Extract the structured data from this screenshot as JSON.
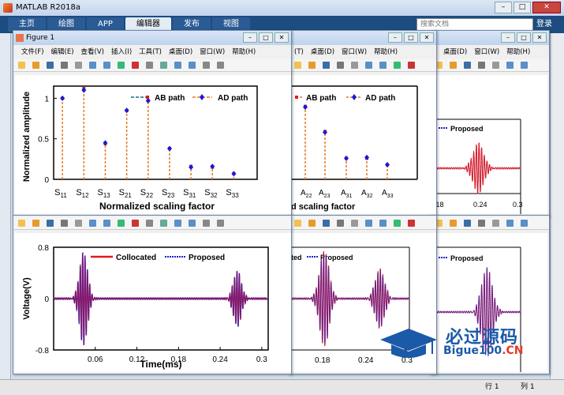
{
  "app": {
    "title": "MATLAB R2018a",
    "tabs": [
      "主页",
      "绘图",
      "APP",
      "编辑器",
      "发布",
      "视图"
    ],
    "active_tab": "编辑器",
    "search_placeholder": "搜索文档",
    "login_label": "登录",
    "status_row_label": "行",
    "status_row_value": "1",
    "status_col_label": "列",
    "status_col_value": "1"
  },
  "figure": {
    "title": "Figure 1",
    "menu": [
      "文件(F)",
      "编辑(E)",
      "查看(V)",
      "插入(I)",
      "工具(T)",
      "桌面(D)",
      "窗口(W)",
      "帮助(H)"
    ],
    "menu_partial": [
      "(T)",
      "桌面(D)",
      "窗口(W)",
      "帮助(H)"
    ],
    "menu_partial2": [
      "工具(T)",
      "桌面(D)",
      "窗口(W)",
      "帮助(H)"
    ]
  },
  "watermark": {
    "line1": "必过源码",
    "line2_main": "Bigue100",
    "line2_suffix": ".CN"
  },
  "chart_data": [
    {
      "type": "stem",
      "ylabel": "Normalized amplitude",
      "xlabel": "Normalized scaling factor",
      "categories": [
        "S11",
        "S12",
        "S13",
        "S21",
        "S22",
        "S23",
        "S31",
        "S32",
        "S33"
      ],
      "ylim": [
        0,
        1.15
      ],
      "yticks": [
        0,
        0.5,
        1
      ],
      "series": [
        {
          "name": "AB path",
          "values": [
            1.0,
            1.12,
            0.44,
            0.85,
            0.97,
            0.38,
            0.16,
            0.15,
            0.07
          ]
        },
        {
          "name": "AD path",
          "values": [
            1.0,
            1.1,
            0.45,
            0.85,
            0.97,
            0.38,
            0.15,
            0.16,
            0.07
          ]
        }
      ],
      "colors": {
        "AB path": "#e3191c",
        "AD path": "#1a1ad6",
        "stem": "#e87722"
      }
    },
    {
      "type": "stem",
      "xlabel_partial": "d scaling factor",
      "categories": [
        "A22",
        "A23",
        "A31",
        "A32",
        "A33"
      ],
      "series": [
        {
          "name": "AB path",
          "values": [
            0.9,
            0.59,
            0.26,
            0.26,
            0.18
          ]
        },
        {
          "name": "AD path",
          "values": [
            0.89,
            0.58,
            0.26,
            0.27,
            0.18
          ]
        }
      ]
    },
    {
      "type": "line",
      "legend_partial": [
        "Proposed"
      ],
      "xticks": [
        "0.18",
        "0.24",
        "0.3"
      ]
    },
    {
      "type": "line",
      "ylabel": "Voltage(V)",
      "xlabel": "Time(ms)",
      "ylim": [
        -0.8,
        0.8
      ],
      "yticks": [
        "-0.8",
        "0",
        "0.8"
      ],
      "xlim": [
        0,
        0.3
      ],
      "xticks": [
        "0.06",
        "0.12",
        "0.18",
        "0.24",
        "0.3"
      ],
      "series": [
        {
          "name": "Collocated",
          "color": "#e3191c"
        },
        {
          "name": "Proposed",
          "color": "#2020c8"
        }
      ],
      "wave_packets": [
        {
          "center_ms": 0.042,
          "amplitude": 0.75,
          "freq_cycles_per_ms": 300
        },
        {
          "center_ms": 0.258,
          "amplitude": 0.45,
          "freq_cycles_per_ms": 300
        }
      ]
    },
    {
      "type": "line",
      "legend_partial": [
        "Proposed"
      ],
      "xticks": [
        "0.18",
        "0.24",
        "0.3"
      ]
    },
    {
      "type": "line",
      "legend_partial": [
        "Proposed"
      ]
    }
  ],
  "text": {
    "stem_legend_ab": "AB path",
    "stem_legend_ad": "AD path",
    "stem_xlabel": "Normalized scaling factor",
    "stem_ylabel": "Normalized amplitude",
    "stem_ytick_1": "1",
    "stem_ytick_05": "0.5",
    "stem_ytick_0": "0",
    "partial_xlabel": "d scaling factor",
    "wave_legend_collocated": "Collocated",
    "wave_legend_proposed": "Proposed",
    "wave_ylabel": "Voltage(V)",
    "wave_xlabel": "Time(ms)",
    "wave_ytick_top": "0.8",
    "wave_ytick_mid": "0",
    "wave_ytick_bot": "-0.8",
    "wave_xticks": [
      "0.06",
      "0.12",
      "0.18",
      "0.24",
      "0.3"
    ],
    "right_xticks": [
      "0.18",
      "0.24",
      "0.3"
    ],
    "partial_legend_ted": "ted",
    "partial_legend_proposed": "Proposed"
  }
}
